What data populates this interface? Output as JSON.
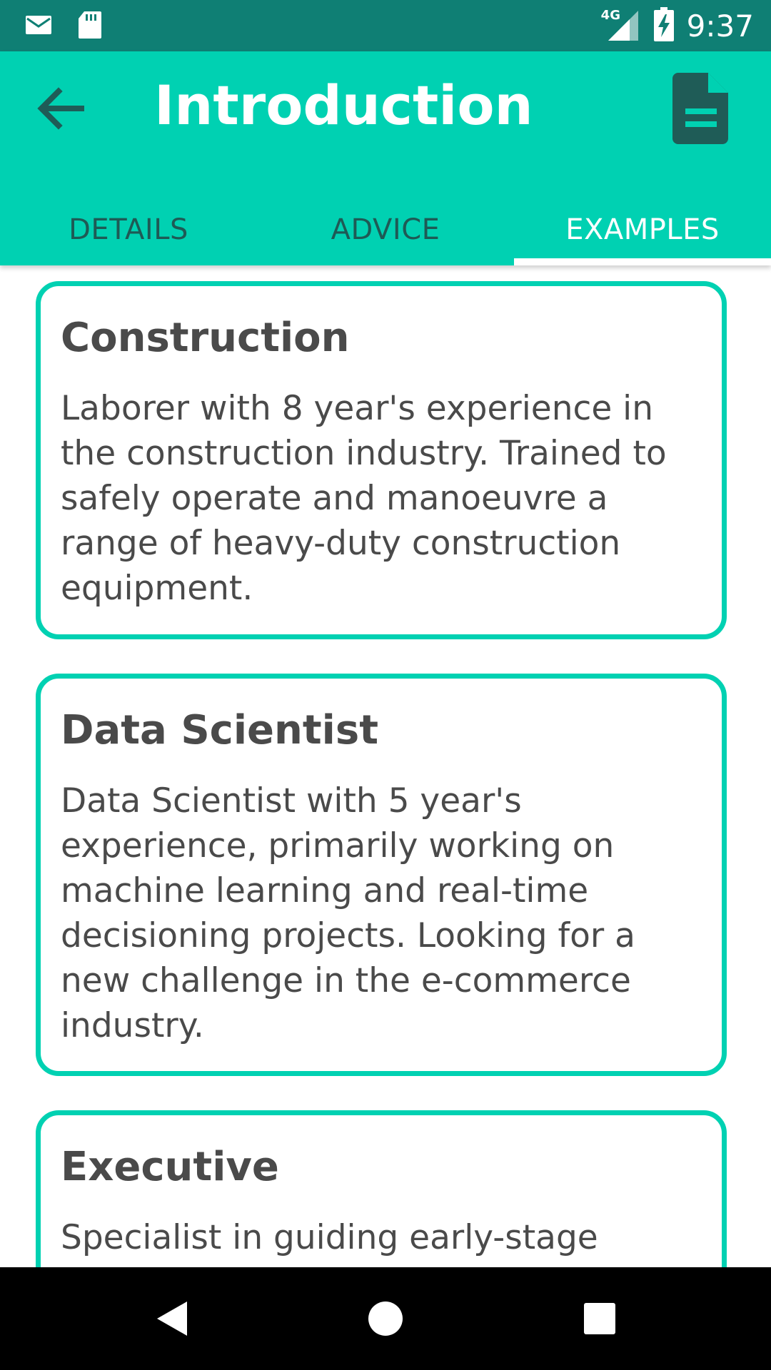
{
  "status_bar": {
    "time": "9:37",
    "network": "4G",
    "icons": [
      "email-icon",
      "sd-card-icon",
      "signal-icon",
      "battery-charging-icon"
    ]
  },
  "app_bar": {
    "title": "Introduction",
    "back_icon": "arrow-back-icon",
    "action_icon": "document-icon"
  },
  "tabs": [
    {
      "label": "DETAILS",
      "active": false
    },
    {
      "label": "ADVICE",
      "active": false
    },
    {
      "label": "EXAMPLES",
      "active": true
    }
  ],
  "examples": [
    {
      "title": "Construction",
      "body": "Laborer with 8 year's experience in the construction industry. Trained to safely operate and manoeuvre a range of heavy-duty construction equipment."
    },
    {
      "title": "Data Scientist",
      "body": "Data Scientist with 5 year's experience, primarily working on machine learning and real-time decisioning projects. Looking for a new challenge in the e-commerce industry."
    },
    {
      "title": "Executive",
      "body": "Specialist in guiding early-stage"
    }
  ],
  "nav_bar": {
    "icons": [
      "nav-back-icon",
      "nav-home-icon",
      "nav-recents-icon"
    ]
  },
  "colors": {
    "accent": "#00d1b2",
    "status_bar": "#0f7f74",
    "tab_inactive_text": "#1e5a55",
    "card_text": "#4a4a4a"
  }
}
